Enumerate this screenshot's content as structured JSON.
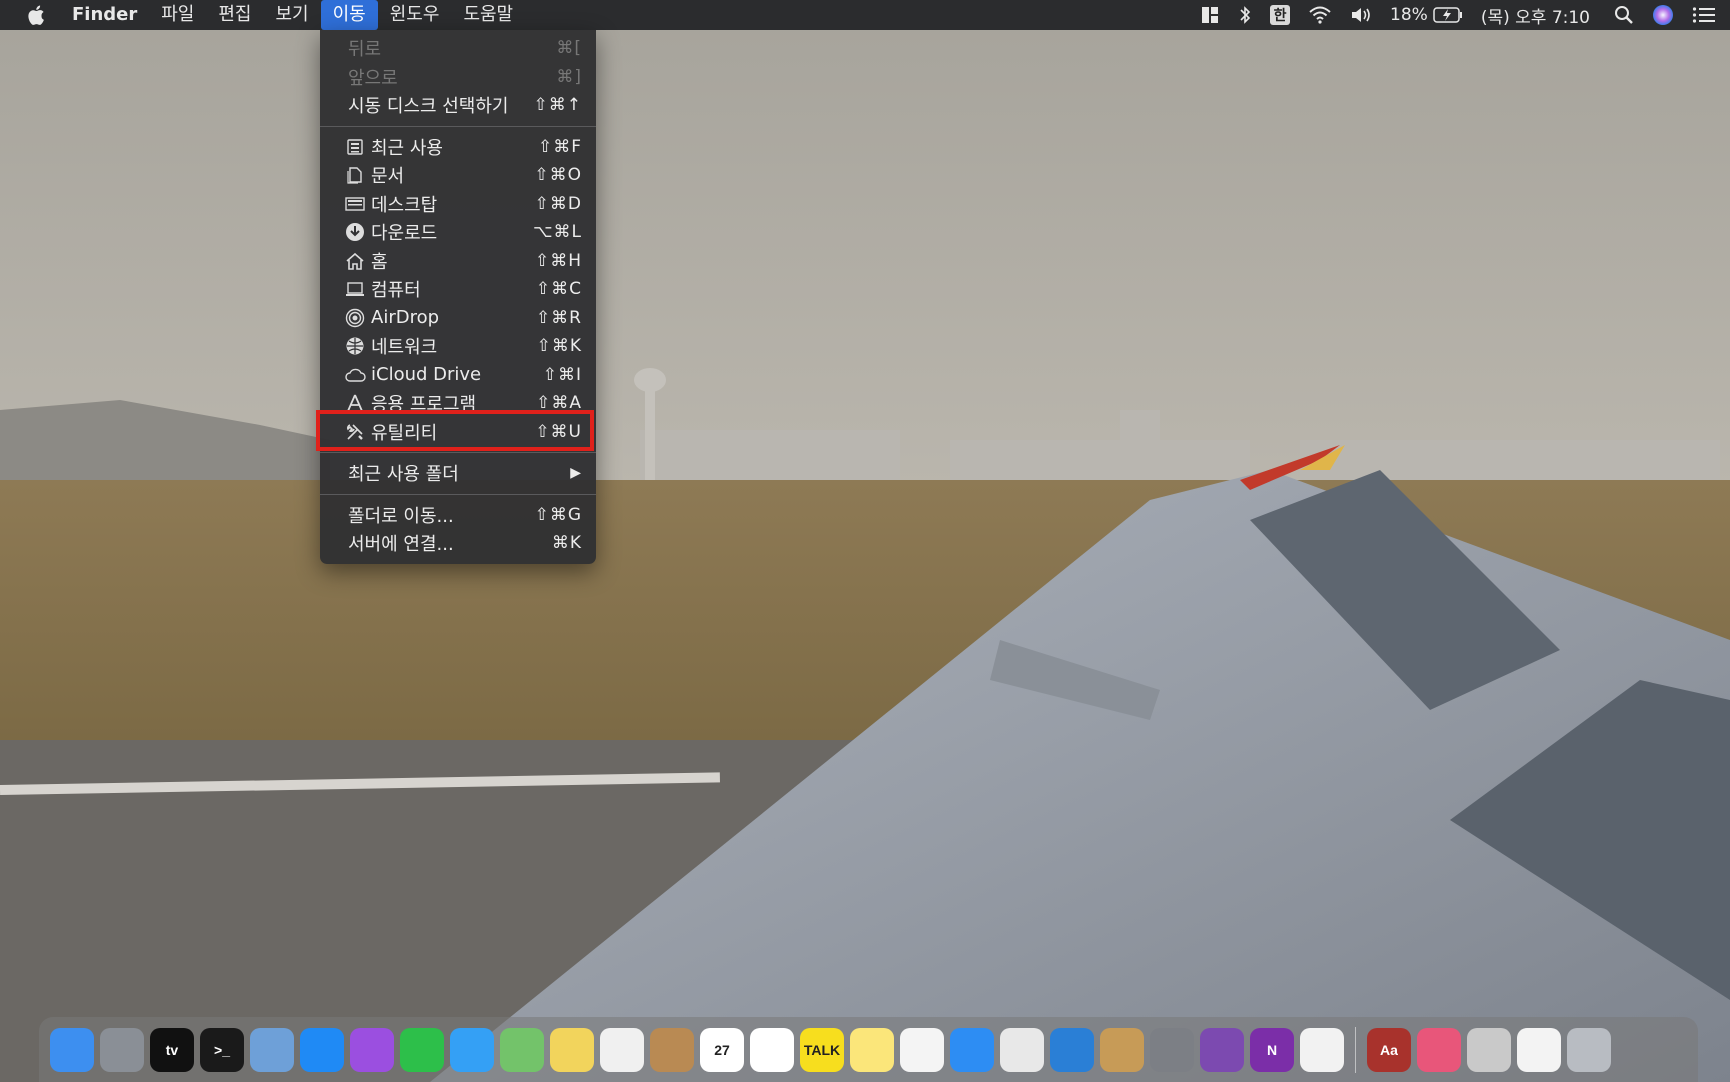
{
  "menubar": {
    "apple_icon": "apple-icon",
    "app_name": "Finder",
    "menus": [
      "파일",
      "편집",
      "보기",
      "이동",
      "윈도우",
      "도움말"
    ],
    "active_menu": "이동",
    "status": {
      "input_source": "한",
      "battery": "18%",
      "clock": "(목) 오후 7:10"
    }
  },
  "go_menu": {
    "items": [
      {
        "label": "뒤로",
        "shortcut": "⌘[",
        "disabled": true,
        "icon": ""
      },
      {
        "label": "앞으로",
        "shortcut": "⌘]",
        "disabled": true,
        "icon": ""
      },
      {
        "label": "시동 디스크 선택하기",
        "shortcut": "⇧⌘↑",
        "disabled": false,
        "icon": ""
      },
      {
        "label": "최근 사용",
        "shortcut": "⇧⌘F",
        "icon": "recents-icon"
      },
      {
        "label": "문서",
        "shortcut": "⇧⌘O",
        "icon": "documents-icon"
      },
      {
        "label": "데스크탑",
        "shortcut": "⇧⌘D",
        "icon": "desktop-icon"
      },
      {
        "label": "다운로드",
        "shortcut": "⌥⌘L",
        "icon": "downloads-icon"
      },
      {
        "label": "홈",
        "shortcut": "⇧⌘H",
        "icon": "home-icon"
      },
      {
        "label": "컴퓨터",
        "shortcut": "⇧⌘C",
        "icon": "computer-icon"
      },
      {
        "label": "AirDrop",
        "shortcut": "⇧⌘R",
        "icon": "airdrop-icon"
      },
      {
        "label": "네트워크",
        "shortcut": "⇧⌘K",
        "icon": "network-icon"
      },
      {
        "label": "iCloud Drive",
        "shortcut": "⇧⌘I",
        "icon": "icloud-icon"
      },
      {
        "label": "응용 프로그램",
        "shortcut": "⇧⌘A",
        "icon": "applications-icon"
      },
      {
        "label": "유틸리티",
        "shortcut": "⇧⌘U",
        "icon": "utilities-icon"
      },
      {
        "label": "최근 사용 폴더",
        "shortcut": "▶",
        "icon": ""
      },
      {
        "label": "폴더로 이동...",
        "shortcut": "⇧⌘G",
        "icon": ""
      },
      {
        "label": "서버에 연결...",
        "shortcut": "⌘K",
        "icon": ""
      }
    ]
  },
  "colors": {
    "menu_highlight": "#2f6fd8",
    "annotation_box": "#e0211b"
  },
  "dock": {
    "apps": [
      {
        "name": "finder-icon",
        "color": "#3d8ff0"
      },
      {
        "name": "launchpad-icon",
        "color": "#8a8f96"
      },
      {
        "name": "apple-tv-icon",
        "color": "#111111",
        "text": "tv"
      },
      {
        "name": "terminal-icon",
        "color": "#1a1a1a",
        "text": ">_"
      },
      {
        "name": "preview-icon",
        "color": "#6ea0d8"
      },
      {
        "name": "app-store-icon",
        "color": "#1f8af5"
      },
      {
        "name": "podcasts-icon",
        "color": "#9b4fe0"
      },
      {
        "name": "facetime-icon",
        "color": "#2dbf4a"
      },
      {
        "name": "messages-icon",
        "color": "#34a0f5"
      },
      {
        "name": "maps-icon",
        "color": "#73c36a"
      },
      {
        "name": "stickies-icon",
        "color": "#f2d45c"
      },
      {
        "name": "photos-icon",
        "color": "#f0f0f0"
      },
      {
        "name": "contacts-icon",
        "color": "#b98a53"
      },
      {
        "name": "calendar-icon",
        "color": "#ffffff",
        "text": "27"
      },
      {
        "name": "reminders-icon",
        "color": "#ffffff"
      },
      {
        "name": "kakaotalk-icon",
        "color": "#f7de1e",
        "text": "TALK"
      },
      {
        "name": "notes-icon",
        "color": "#fbe67a"
      },
      {
        "name": "music-icon",
        "color": "#f4f4f4"
      },
      {
        "name": "safari-icon",
        "color": "#2d8df3"
      },
      {
        "name": "chrome-icon",
        "color": "#e8e8e8"
      },
      {
        "name": "vscode-icon",
        "color": "#2a7fd6"
      },
      {
        "name": "archive-utility-icon",
        "color": "#c79b57"
      },
      {
        "name": "system-preferences-icon",
        "color": "#7c7f85"
      },
      {
        "name": "github-desktop-icon",
        "color": "#7c4ab0"
      },
      {
        "name": "onenote-icon",
        "color": "#7b2ea8",
        "text": "N"
      },
      {
        "name": "textedit-icon",
        "color": "#f2f2f2"
      }
    ],
    "right_items": [
      {
        "name": "dictionary-icon",
        "color": "#a8322c",
        "text": "Aa"
      },
      {
        "name": "folder-icon",
        "color": "#e8567a"
      },
      {
        "name": "disk-utility-icon",
        "color": "#c9c9c9"
      },
      {
        "name": "documents-stack-icon",
        "color": "#f3f3f3"
      },
      {
        "name": "trash-icon",
        "color": "#b8bcc2"
      }
    ]
  }
}
